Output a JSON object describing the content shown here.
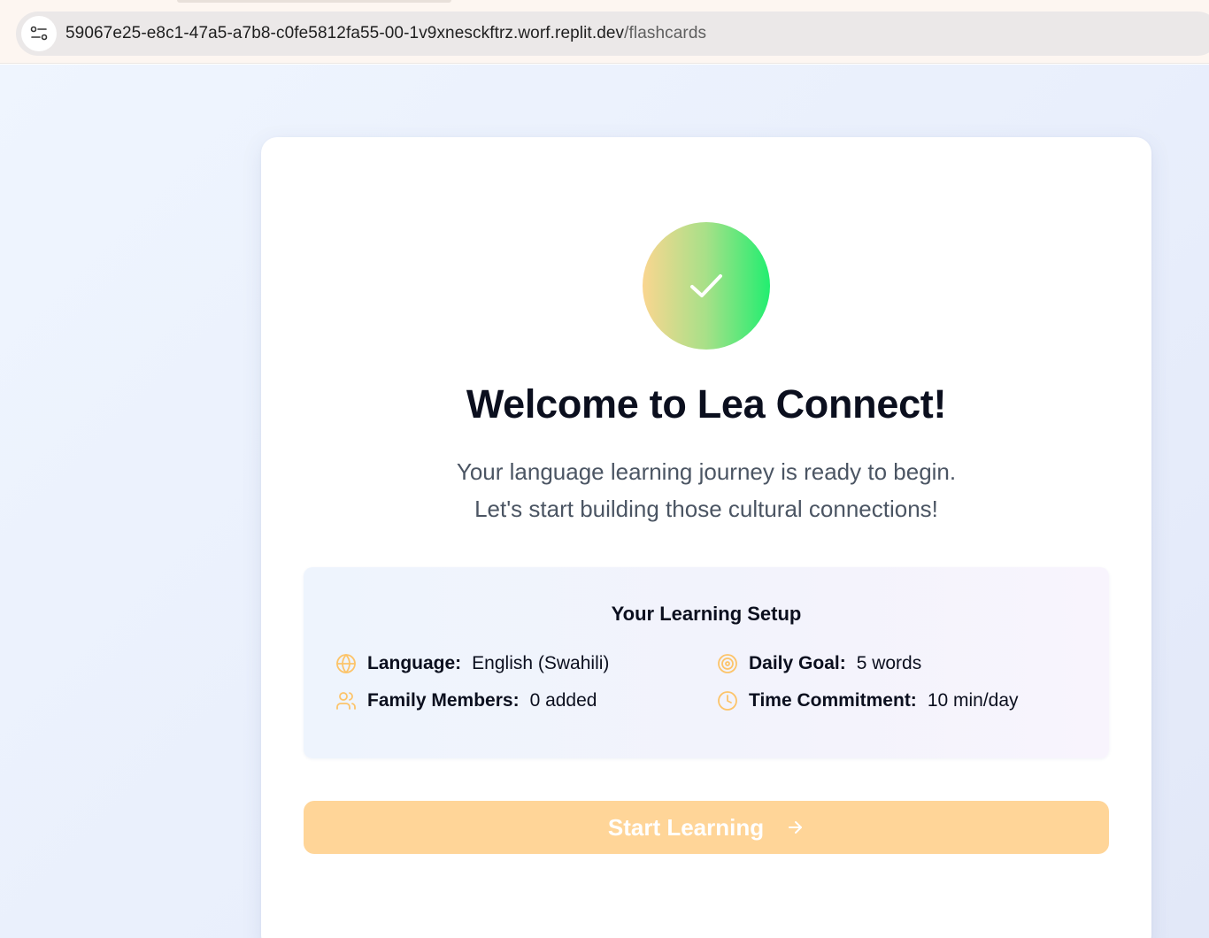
{
  "browser": {
    "url_host": "59067e25-e8c1-47a5-a7b8-c0fe5812fa55-00-1v9xnesckftrz.worf.replit.dev",
    "url_path": "/flashcards"
  },
  "welcome": {
    "title": "Welcome to Lea Connect!",
    "subtitle_line1": "Your language learning journey is ready to begin.",
    "subtitle_line2": "Let's start building those cultural connections!"
  },
  "setup": {
    "title": "Your Learning Setup",
    "items": [
      {
        "label": "Language:",
        "value": "English (Swahili)",
        "icon": "globe-icon"
      },
      {
        "label": "Daily Goal:",
        "value": "5 words",
        "icon": "target-icon"
      },
      {
        "label": "Family Members:",
        "value": "0 added",
        "icon": "users-icon"
      },
      {
        "label": "Time Commitment:",
        "value": "10 min/day",
        "icon": "clock-icon"
      }
    ]
  },
  "cta": {
    "label": "Start Learning"
  },
  "colors": {
    "accent": "#ffd598",
    "icon": "#fcc46a",
    "check_gradient_start": "#fad690",
    "check_gradient_end": "#22ee70"
  }
}
